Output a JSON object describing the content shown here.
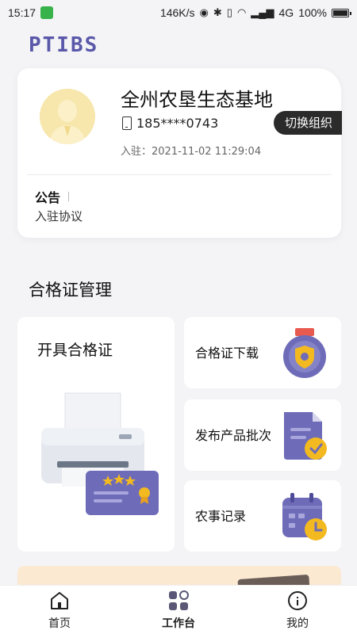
{
  "status_bar": {
    "time": "15:17",
    "net_speed": "146K/s",
    "signal": "4G",
    "battery": "100%"
  },
  "brand": {
    "logo_text": "PTIBS"
  },
  "profile": {
    "org_name": "全州农垦生态基地",
    "phone": "185****0743",
    "join_label": "入驻：",
    "join_time": "2021-11-02 11:29:04",
    "switch_button": "切换组织"
  },
  "notice": {
    "title": "公告",
    "link": "入驻协议"
  },
  "section": {
    "title": "合格证管理"
  },
  "cards": {
    "issue": "开具合格证",
    "download": "合格证下载",
    "publish_batch": "发布产品批次",
    "farm_record": "农事记录"
  },
  "tabs": [
    {
      "label": "首页",
      "icon": "home-icon"
    },
    {
      "label": "工作台",
      "icon": "grid-icon"
    },
    {
      "label": "我的",
      "icon": "user-icon"
    }
  ],
  "colors": {
    "brand": "#5a58a8",
    "accent_purple": "#6e6cb8",
    "accent_yellow": "#f2b920",
    "accent_red": "#e85a4f"
  }
}
